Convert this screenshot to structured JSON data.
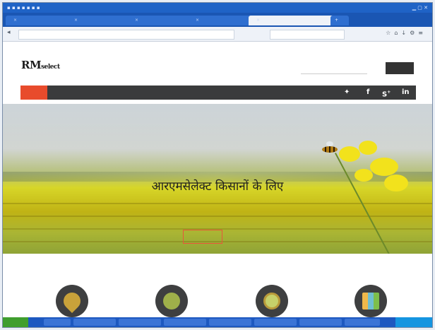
{
  "hero": {
    "title": "आरएमसेलेक्ट किसानों के लिए"
  },
  "colors": {
    "nav_home": "#e84b2c",
    "nav_bg": "#3a3b3c",
    "icon_circle": "#3e3f40",
    "os_bar": "#1f63c6",
    "taskbar": "#1d58c0"
  },
  "icons": {
    "header_social": [
      "twitter-icon",
      "facebook-icon",
      "google-plus-icon",
      "linkedin-icon"
    ],
    "features": [
      "map-pin-crop-icon",
      "field-globe-icon",
      "magnifier-plant-icon",
      "bar-chart-icon"
    ]
  }
}
